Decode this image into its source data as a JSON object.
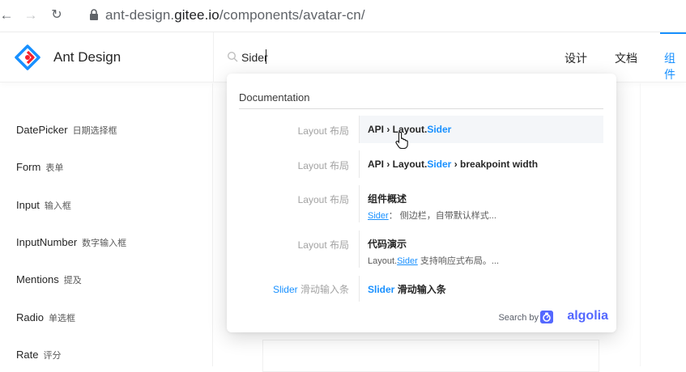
{
  "browser": {
    "url_dim": "ant-design.",
    "url_host": "gitee.io",
    "url_path": "/components/avatar-cn/"
  },
  "header": {
    "brand": "Ant Design",
    "search_value": "Sider",
    "nav": [
      "设计",
      "文档",
      "组件"
    ],
    "accent": "#1890ff"
  },
  "sidebar": {
    "items": [
      {
        "en": "DatePicker",
        "cn": "日期选择框"
      },
      {
        "en": "Form",
        "cn": "表单"
      },
      {
        "en": "Input",
        "cn": "输入框"
      },
      {
        "en": "InputNumber",
        "cn": "数字输入框"
      },
      {
        "en": "Mentions",
        "cn": "提及"
      },
      {
        "en": "Radio",
        "cn": "单选框"
      },
      {
        "en": "Rate",
        "cn": "评分"
      }
    ]
  },
  "dropdown": {
    "section": "Documentation",
    "results": [
      {
        "cat_hl": "",
        "cat": "Layout 布局",
        "title_pre": "API › Layout.",
        "title_hl": "Sider",
        "title_post": "",
        "sub_hl": "",
        "sub": ""
      },
      {
        "cat_hl": "",
        "cat": "Layout 布局",
        "title_pre": "API › Layout.",
        "title_hl": "Sider",
        "title_post": " › breakpoint width",
        "sub_hl": "",
        "sub": ""
      },
      {
        "cat_hl": "",
        "cat": "Layout 布局",
        "title_pre": "组件概述",
        "title_hl": "",
        "title_post": "",
        "sub_pre": "",
        "sub_hl": "Sider",
        "sub": "： 侧边栏，自带默认样式..."
      },
      {
        "cat_hl": "",
        "cat": "Layout 布局",
        "title_pre": "代码演示",
        "title_hl": "",
        "title_post": "",
        "sub_pre": "Layout.",
        "sub_hl": "Sider",
        "sub": " 支持响应式布局。..."
      },
      {
        "cat_hl": "Slider",
        "cat": " 滑动输入条",
        "title_pre": "",
        "title_hl": "Slider",
        "title_post": " 滑动输入条",
        "sub_hl": "",
        "sub": ""
      }
    ],
    "search_by": "Search by",
    "algolia": "algolia",
    "algolia_color": "#5468ff"
  }
}
